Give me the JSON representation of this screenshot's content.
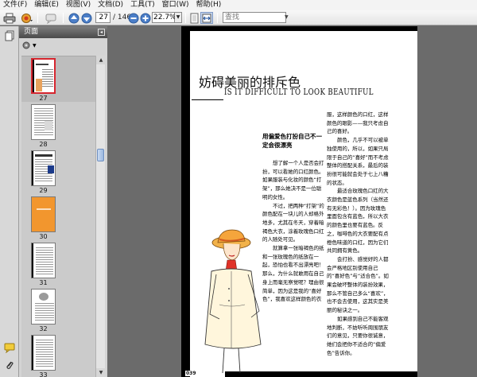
{
  "menu": {
    "items": [
      "文件(F)",
      "编辑(E)",
      "视图(V)",
      "文档(D)",
      "工具(T)",
      "窗口(W)",
      "帮助(H)"
    ]
  },
  "toolbar": {
    "current_page": "27",
    "total_pages": "/ 146",
    "zoom": "22.7%",
    "zoom_dropdown": "▼",
    "search_placeholder": "查找",
    "search_dropdown": "▼"
  },
  "panel": {
    "title": "页面",
    "close": "◂",
    "options_dropdown": "▼",
    "thumbnails": [
      {
        "label": "27",
        "selected": true
      },
      {
        "label": "28",
        "selected": false
      },
      {
        "label": "29",
        "selected": false
      },
      {
        "label": "30",
        "selected": false
      },
      {
        "label": "31",
        "selected": false
      },
      {
        "label": "32",
        "selected": false
      },
      {
        "label": "33",
        "selected": false
      }
    ],
    "scroll_up": "▲",
    "scroll_down": "▼"
  },
  "document": {
    "title_cn": "妨碍美丽的排斥色",
    "title_en": "IS IT DIFFICULT TO LOOK BEAUTIFUL",
    "subhead": "用偏爱色打扮自己不一定会很漂亮",
    "col1": [
      "想了解一个人是否会打扮，可以看她的口红颜色。如果服装与化妆的颜色“打架”，那么她决不是一位聪明的女性。",
      "不过，把两种“打架”的颜色配在一块儿的人却格外地多，尤其在冬天，穿着暗褐色大衣，涂着玫瑰色口红的人随处可见。",
      "就算拿一张暗褐色的纸和一张玫瑰色的纸放在一起，恐怕也看不出漂亮吧！那么，为什么就敢用在自己身上而毫无察觉呢？理由很简单，因为这是我的“喜好色”，我喜欢这样颜色的衣"
    ],
    "col2": [
      "服，这样颜色的口红，这样颜色的眼影——我只考虑自己的喜好。",
      "颜色，几乎不可以被单独使用的，所以，如果只局限于自己的“喜好”而不考虑整体的搭配关系，最后的装扮很可能就会处于七上八糟的状态。",
      "最适合玫瑰色口红的大衣颜色是蓝色系列（当然还有无彩色！）。因为玫瑰色里面包含有蓝色，所以大衣的颜色里也要有蓝色。反之，咖啡色的大衣要配有点橙色味道的口红，因为它们共同拥有黄色。",
      "会打扮、感觉好的人都会严格地区别使用自己的“喜好色”与“适合色”。如果会破坏整体的装扮效果，那么不管自己多么“喜欢”，也不会去使用，这其实是美丽的秘诀之一。",
      "如果感到自己不能客观地判断，不妨听听周围朋友们的意见，只要你很诚意，她们会把你不适合的“偏爱色”告诉你。"
    ],
    "page_number": "039"
  }
}
